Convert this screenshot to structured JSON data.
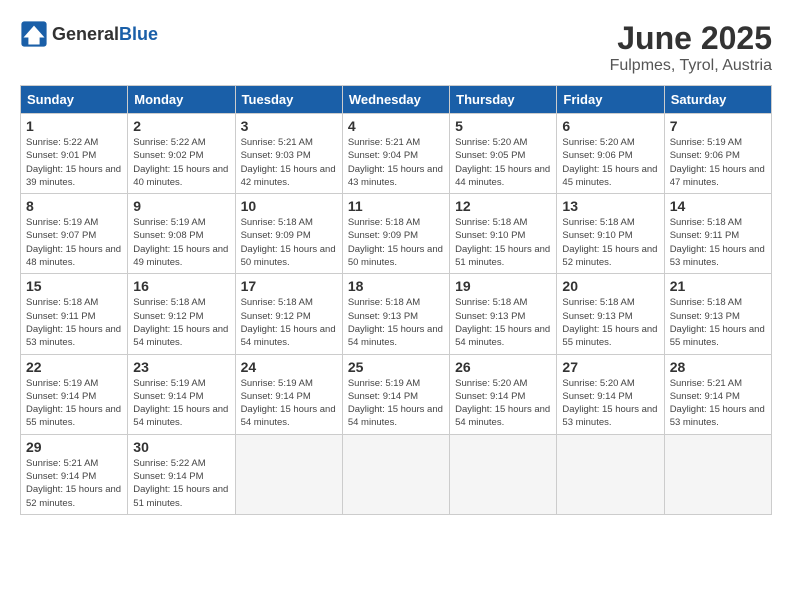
{
  "logo": {
    "general": "General",
    "blue": "Blue"
  },
  "title": "June 2025",
  "subtitle": "Fulpmes, Tyrol, Austria",
  "weekdays": [
    "Sunday",
    "Monday",
    "Tuesday",
    "Wednesday",
    "Thursday",
    "Friday",
    "Saturday"
  ],
  "days": [
    {
      "day": null
    },
    {
      "day": "1",
      "sunrise": "5:22 AM",
      "sunset": "9:01 PM",
      "daylight": "15 hours and 39 minutes."
    },
    {
      "day": "2",
      "sunrise": "5:22 AM",
      "sunset": "9:02 PM",
      "daylight": "15 hours and 40 minutes."
    },
    {
      "day": "3",
      "sunrise": "5:21 AM",
      "sunset": "9:03 PM",
      "daylight": "15 hours and 42 minutes."
    },
    {
      "day": "4",
      "sunrise": "5:21 AM",
      "sunset": "9:04 PM",
      "daylight": "15 hours and 43 minutes."
    },
    {
      "day": "5",
      "sunrise": "5:20 AM",
      "sunset": "9:05 PM",
      "daylight": "15 hours and 44 minutes."
    },
    {
      "day": "6",
      "sunrise": "5:20 AM",
      "sunset": "9:06 PM",
      "daylight": "15 hours and 45 minutes."
    },
    {
      "day": "7",
      "sunrise": "5:19 AM",
      "sunset": "9:06 PM",
      "daylight": "15 hours and 47 minutes."
    },
    {
      "day": "8",
      "sunrise": "5:19 AM",
      "sunset": "9:07 PM",
      "daylight": "15 hours and 48 minutes."
    },
    {
      "day": "9",
      "sunrise": "5:19 AM",
      "sunset": "9:08 PM",
      "daylight": "15 hours and 49 minutes."
    },
    {
      "day": "10",
      "sunrise": "5:18 AM",
      "sunset": "9:09 PM",
      "daylight": "15 hours and 50 minutes."
    },
    {
      "day": "11",
      "sunrise": "5:18 AM",
      "sunset": "9:09 PM",
      "daylight": "15 hours and 50 minutes."
    },
    {
      "day": "12",
      "sunrise": "5:18 AM",
      "sunset": "9:10 PM",
      "daylight": "15 hours and 51 minutes."
    },
    {
      "day": "13",
      "sunrise": "5:18 AM",
      "sunset": "9:10 PM",
      "daylight": "15 hours and 52 minutes."
    },
    {
      "day": "14",
      "sunrise": "5:18 AM",
      "sunset": "9:11 PM",
      "daylight": "15 hours and 53 minutes."
    },
    {
      "day": "15",
      "sunrise": "5:18 AM",
      "sunset": "9:11 PM",
      "daylight": "15 hours and 53 minutes."
    },
    {
      "day": "16",
      "sunrise": "5:18 AM",
      "sunset": "9:12 PM",
      "daylight": "15 hours and 54 minutes."
    },
    {
      "day": "17",
      "sunrise": "5:18 AM",
      "sunset": "9:12 PM",
      "daylight": "15 hours and 54 minutes."
    },
    {
      "day": "18",
      "sunrise": "5:18 AM",
      "sunset": "9:13 PM",
      "daylight": "15 hours and 54 minutes."
    },
    {
      "day": "19",
      "sunrise": "5:18 AM",
      "sunset": "9:13 PM",
      "daylight": "15 hours and 54 minutes."
    },
    {
      "day": "20",
      "sunrise": "5:18 AM",
      "sunset": "9:13 PM",
      "daylight": "15 hours and 55 minutes."
    },
    {
      "day": "21",
      "sunrise": "5:18 AM",
      "sunset": "9:13 PM",
      "daylight": "15 hours and 55 minutes."
    },
    {
      "day": "22",
      "sunrise": "5:19 AM",
      "sunset": "9:14 PM",
      "daylight": "15 hours and 55 minutes."
    },
    {
      "day": "23",
      "sunrise": "5:19 AM",
      "sunset": "9:14 PM",
      "daylight": "15 hours and 54 minutes."
    },
    {
      "day": "24",
      "sunrise": "5:19 AM",
      "sunset": "9:14 PM",
      "daylight": "15 hours and 54 minutes."
    },
    {
      "day": "25",
      "sunrise": "5:19 AM",
      "sunset": "9:14 PM",
      "daylight": "15 hours and 54 minutes."
    },
    {
      "day": "26",
      "sunrise": "5:20 AM",
      "sunset": "9:14 PM",
      "daylight": "15 hours and 54 minutes."
    },
    {
      "day": "27",
      "sunrise": "5:20 AM",
      "sunset": "9:14 PM",
      "daylight": "15 hours and 53 minutes."
    },
    {
      "day": "28",
      "sunrise": "5:21 AM",
      "sunset": "9:14 PM",
      "daylight": "15 hours and 53 minutes."
    },
    {
      "day": "29",
      "sunrise": "5:21 AM",
      "sunset": "9:14 PM",
      "daylight": "15 hours and 52 minutes."
    },
    {
      "day": "30",
      "sunrise": "5:22 AM",
      "sunset": "9:14 PM",
      "daylight": "15 hours and 51 minutes."
    },
    {
      "day": null
    },
    {
      "day": null
    },
    {
      "day": null
    },
    {
      "day": null
    },
    {
      "day": null
    }
  ]
}
